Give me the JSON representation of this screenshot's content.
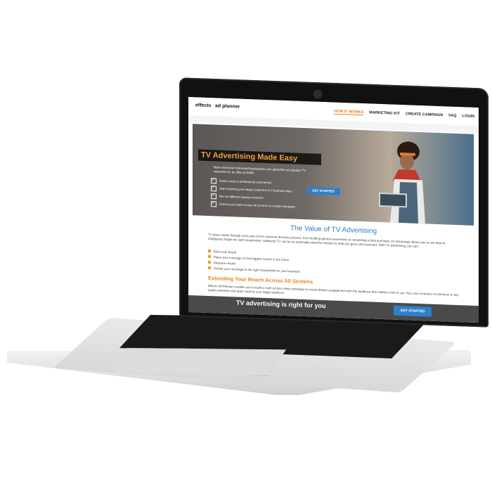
{
  "nav": {
    "logo": "effectv",
    "logo_sub": "ad planner",
    "links": [
      {
        "label": "HOW IT WORKS",
        "active": true
      },
      {
        "label": "MARKETING KIT",
        "active": false
      },
      {
        "label": "CREATE CAMPAIGN",
        "active": false
      },
      {
        "label": "FAQ",
        "active": false
      },
      {
        "label": "LOGIN",
        "active": false
      }
    ]
  },
  "hero": {
    "title": "TV Advertising Made Easy",
    "intro": "New small and mid-sized businesses can advertise on popular TV networks for as little as $400.",
    "checklist": [
      "Easily create a professional commercial",
      "Start reaching your target customers in 3 business days",
      "Run on different popular networks",
      "Extend your reach across all screens in a single campaign"
    ],
    "cta": "GET STARTED"
  },
  "value": {
    "title": "The Value of TV Advertising",
    "paragraph": "TV plays nearly through every part of the customer decision process, from building general awareness to completing a final purchase. As technology allows you to use data to intelligently target the right households, traditional TV can be an especially powerful medium to help you grow your business. With TV advertising, you can:",
    "bullets": [
      "Build your brand",
      "Place your message on the biggest screen in the home",
      "Measure results",
      "Deliver your message to the right households for your business"
    ]
  },
  "reach": {
    "title": "Extending Your Reach Across All Screens",
    "paragraph": "Effectv Ad Planner enables you to build a multi-screen video campaign to create deeper engagement with the audience that matters most to you. Run your inventory on premium or top-quality websites and apps used by your target audience."
  },
  "footer": {
    "text": "TV advertising is right for you",
    "cta": "GET STARTED"
  },
  "colors": {
    "accent_blue": "#2f7fc9",
    "accent_orange": "#e08a22",
    "hero_title": "#f2a23a"
  }
}
